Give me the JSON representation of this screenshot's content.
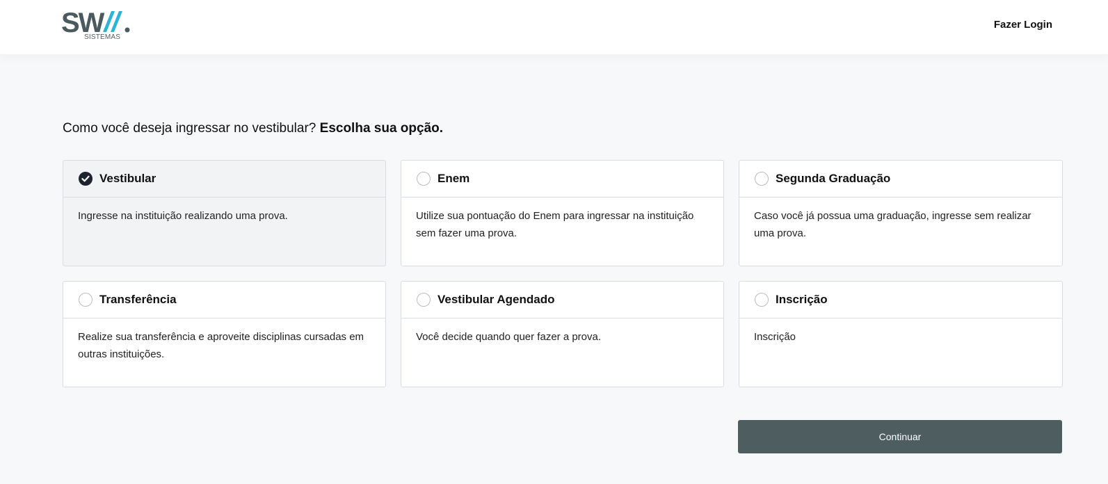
{
  "header": {
    "logo_text": "SWA.",
    "logo_subtext": "SISTEMAS",
    "logo_colors": {
      "dark": "#4a5a5e",
      "accent": "#2bb4d8"
    },
    "login_label": "Fazer Login"
  },
  "question": {
    "prefix": "Como você deseja ingressar no vestibular?",
    "emphasis": "Escolha sua opção."
  },
  "options": [
    {
      "title": "Vestibular",
      "description": "Ingresse na instituição realizando uma prova.",
      "selected": true
    },
    {
      "title": "Enem",
      "description": "Utilize sua pontuação do Enem para ingressar na instituição sem fazer uma prova.",
      "selected": false
    },
    {
      "title": "Segunda Graduação",
      "description": "Caso você já possua uma graduação, ingresse sem realizar uma prova.",
      "selected": false
    },
    {
      "title": "Transferência",
      "description": "Realize sua transferência e aproveite disciplinas cursadas em outras instituições.",
      "selected": false
    },
    {
      "title": "Vestibular Agendado",
      "description": "Você decide quando quer fazer a prova.",
      "selected": false
    },
    {
      "title": "Inscrição",
      "description": "Inscrição",
      "selected": false
    }
  ],
  "actions": {
    "continue_label": "Continuar",
    "continue_color": "#4d5d60"
  }
}
